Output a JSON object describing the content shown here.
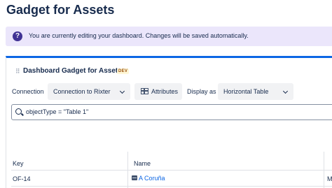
{
  "page": {
    "title": "Gadget for Assets"
  },
  "banner": {
    "icon": "question-icon",
    "icon_glyph": "?",
    "text": "You are currently editing your dashboard. Changes will be saved automatically."
  },
  "gadget": {
    "title": "Dashboard Gadget for Assets",
    "badge": "DEV",
    "handle_glyph": "⠿",
    "accent_color": "#0c66e4",
    "connection": {
      "label": "Connection",
      "value": "Connection to Rixter"
    },
    "attributes_label": "Attributes",
    "display": {
      "label": "Display as",
      "value": "Horizontal Table"
    },
    "query": "objectType = \"Table 1\""
  },
  "table": {
    "headers": [
      "Key",
      "Name"
    ],
    "rows": [
      {
        "key": "OF-14",
        "name": "A Coruña",
        "icon": "object-icon",
        "trailing": "M"
      }
    ]
  }
}
